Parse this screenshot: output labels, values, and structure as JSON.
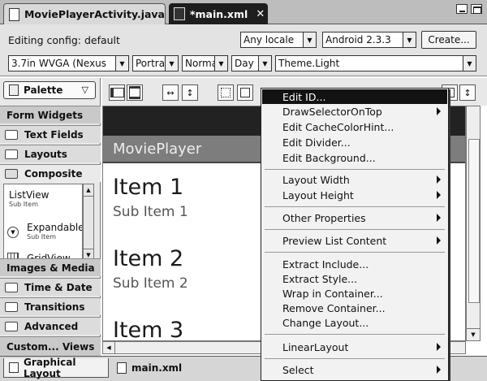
{
  "tabs": [
    {
      "label": "MoviePlayerActivity.java",
      "active": false
    },
    {
      "label": "*main.xml",
      "active": true,
      "close": "✕"
    }
  ],
  "config": {
    "editing_label": "Editing config: default",
    "locale": "Any locale",
    "android_version": "Android 2.3.3",
    "create_button": "Create...",
    "device": "3.7in WVGA (Nexus",
    "orientation": "Portra",
    "density": "Norma",
    "mode": "Day",
    "theme": "Theme.Light"
  },
  "palette": {
    "title": "Palette",
    "categories": {
      "form_widgets": "Form Widgets",
      "text_fields": "Text Fields",
      "layouts": "Layouts",
      "composite": "Composite",
      "images_media": "Images & Media",
      "time_date": "Time & Date",
      "transitions": "Transitions",
      "advanced": "Advanced",
      "custom_views": "Custom... Views"
    },
    "widgets": [
      {
        "label": "ListView",
        "sub": "Sub Item"
      },
      {
        "label": "Expandable",
        "sub": "Sub Item"
      },
      {
        "label": "GridView",
        "sub": ""
      }
    ]
  },
  "canvas": {
    "title": "MoviePlayer",
    "items": [
      {
        "title": "Item 1",
        "sub": "Sub Item 1"
      },
      {
        "title": "Item 2",
        "sub": "Sub Item 2"
      },
      {
        "title": "Item 3",
        "sub": ""
      }
    ]
  },
  "bottom_tabs": {
    "graphical": "Graphical Layout",
    "xml": "main.xml"
  },
  "context_menu": {
    "groups": [
      [
        {
          "label": "Edit ID...",
          "selected": true,
          "submenu": false
        },
        {
          "label": "DrawSelectorOnTop",
          "submenu": true
        },
        {
          "label": "Edit CacheColorHint...",
          "submenu": false
        },
        {
          "label": "Edit Divider...",
          "submenu": false
        },
        {
          "label": "Edit Background...",
          "submenu": false
        }
      ],
      [
        {
          "label": "Layout Width",
          "submenu": true
        },
        {
          "label": "Layout Height",
          "submenu": true
        }
      ],
      [
        {
          "label": "Other Properties",
          "submenu": true
        }
      ],
      [
        {
          "label": "Preview List Content",
          "submenu": true
        }
      ],
      [
        {
          "label": "Extract Include...",
          "submenu": false
        },
        {
          "label": "Extract Style...",
          "submenu": false
        },
        {
          "label": "Wrap in Container...",
          "submenu": false
        },
        {
          "label": "Remove Container...",
          "submenu": false
        },
        {
          "label": "Change Layout...",
          "submenu": false
        }
      ],
      [
        {
          "label": "LinearLayout",
          "submenu": true
        }
      ],
      [
        {
          "label": "Select",
          "submenu": true
        }
      ]
    ]
  }
}
